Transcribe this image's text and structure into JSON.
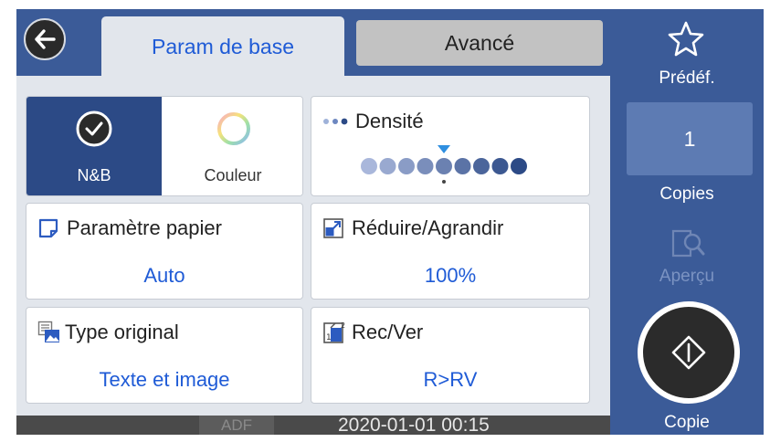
{
  "tabs": {
    "basic": "Param de base",
    "advanced": "Avancé"
  },
  "mode": {
    "bw_label": "N&B",
    "color_label": "Couleur",
    "selected": "N&B"
  },
  "density": {
    "label": "Densité",
    "level": 5,
    "levels": 9
  },
  "paper": {
    "label": "Paramètre papier",
    "value": "Auto"
  },
  "zoom": {
    "label": "Réduire/Agrandir",
    "value": "100%"
  },
  "original_type": {
    "label": "Type original",
    "value": "Texte et image"
  },
  "duplex": {
    "label": "Rec/Ver",
    "value": "R>RV"
  },
  "status": {
    "adf": "ADF",
    "datetime": "2020-01-01 00:15"
  },
  "rail": {
    "preset_label": "Prédéf.",
    "copies_value": "1",
    "copies_label": "Copies",
    "preview_label": "Aperçu",
    "start_label": "Copie"
  },
  "colors": {
    "accent": "#3b5b98",
    "selected": "#2c4a86",
    "value_text": "#1f5bd6"
  }
}
